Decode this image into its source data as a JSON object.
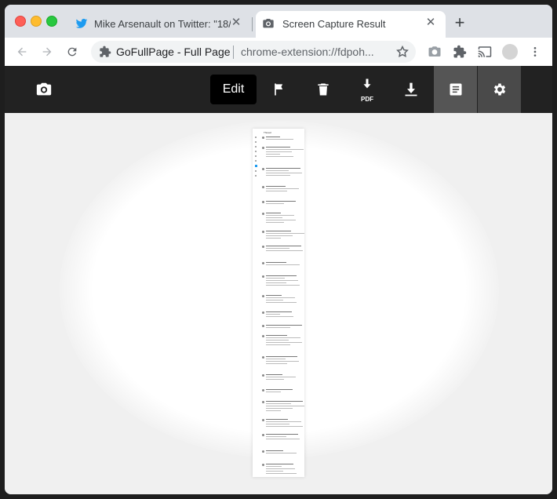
{
  "browser": {
    "tabs": [
      {
        "title": "Mike Arsenault on Twitter: \"18/",
        "icon": "twitter-bird-icon",
        "active": false
      },
      {
        "title": "Screen Capture Result",
        "icon": "camera-icon",
        "active": true
      }
    ],
    "omnibox": {
      "site_label": "GoFullPage - Full Page",
      "url": "chrome-extension://fdpoh..."
    }
  },
  "app": {
    "edit_label": "Edit",
    "pdf_label": "PDF",
    "toolbar_icons": [
      "camera-icon",
      "flag-icon",
      "trash-icon",
      "download-pdf-icon",
      "download-icon",
      "document-icon",
      "gear-icon"
    ]
  },
  "preview": {
    "header_text": "Thread"
  },
  "colors": {
    "appbar_bg": "#222222",
    "active_tool_bg": "#555555",
    "twitter_blue": "#1d9bf0"
  }
}
